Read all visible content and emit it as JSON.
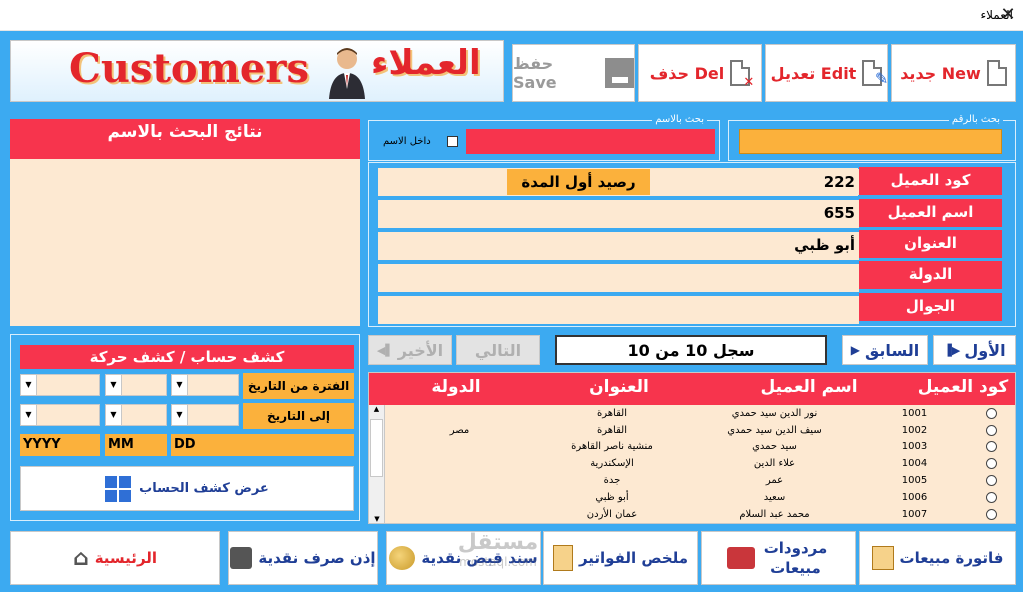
{
  "window": {
    "title": "العملاء",
    "close": "✕"
  },
  "toolbar": {
    "new_label": "جديد New",
    "edit_label": "تعديل Edit",
    "del_label": "حذف Del",
    "save_label": "حفظ Save"
  },
  "banner": {
    "arabic": "العملاء",
    "english": "Customers"
  },
  "search": {
    "by_number_label": "بحث بالرقم",
    "by_number_value": "",
    "by_name_label": "بحث بالاسم",
    "by_name_value": "",
    "inside_name_label": "داخل الاسم",
    "results_header": "نتائج البحث بالاسم"
  },
  "form": {
    "code_label": "كود العميل",
    "code_value": "222",
    "opening_balance_label": "رصيد أول المدة",
    "opening_balance_value": "",
    "name_label": "اسم العميل",
    "name_value": "655",
    "address_label": "العنوان",
    "address_value": "أبو ظبي",
    "country_label": "الدولة",
    "country_value": "",
    "mobile_label": "الجوال",
    "mobile_value": ""
  },
  "nav": {
    "first": "الأول",
    "prev": "السابق",
    "record": "سجل 10 من 10",
    "next": "التالي",
    "last": "الأخير"
  },
  "statement": {
    "header": "كشف حساب / كشف حركة",
    "from_label": "الفترة من التاريخ",
    "to_label": "إلى التاريخ",
    "dd": "DD",
    "mm": "MM",
    "yyyy": "YYYY",
    "show_button": "عرض كشف الحساب"
  },
  "table": {
    "headers": [
      "كود العميل",
      "اسم العميل",
      "العنوان",
      "الدولة"
    ],
    "rows": [
      [
        "1001",
        "نور الدين سيد حمدي",
        "القاهرة",
        ""
      ],
      [
        "1002",
        "سيف الدين سيد حمدي",
        "القاهرة",
        "مصر"
      ],
      [
        "1003",
        "سيد حمدي",
        "منشية ناصر القاهرة",
        ""
      ],
      [
        "1004",
        "علاء الدين",
        "الإسكندرية",
        ""
      ],
      [
        "1005",
        "عمر",
        "جدة",
        ""
      ],
      [
        "1006",
        "سعيد",
        "أبو ظبي",
        ""
      ],
      [
        "1007",
        "محمد عبد السلام",
        "عمان الأردن",
        ""
      ]
    ]
  },
  "bottom": {
    "sales_invoice": "فاتورة مبيعات",
    "sales_returns": "مردودات مبيعات",
    "invoices_summary": "ملخص الفواتير",
    "receipt_voucher": "سند قبض نقدية",
    "payment_voucher": "إذن صرف نقدية",
    "home": "الرئيسية"
  },
  "watermark": {
    "arabic": "مستقل",
    "latin": "mostaql.com"
  },
  "colors": {
    "frame": "#3caaf1",
    "red": "#f7344d",
    "cream": "#fde9d2",
    "orange": "#fbb13c",
    "navy": "#1f3e96"
  }
}
